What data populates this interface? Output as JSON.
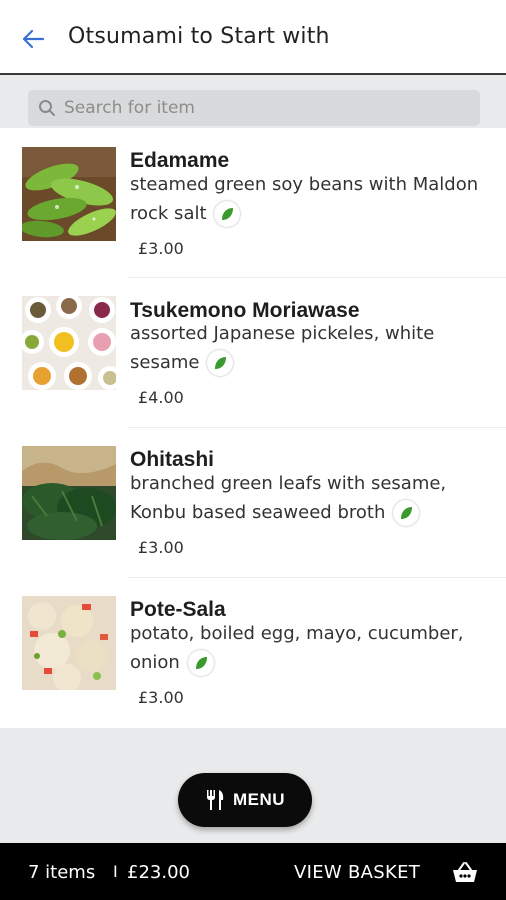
{
  "header": {
    "title": "Otsumami to Start with",
    "back_icon": "arrow-left-icon",
    "accent": "#3b6fd6"
  },
  "search": {
    "placeholder": "Search for item",
    "icon": "search-icon"
  },
  "items": [
    {
      "name": "Edamame",
      "desc": "steamed green soy beans with Maldon rock salt",
      "price": "£3.00",
      "vegetarian": true,
      "image": "edamame-photo"
    },
    {
      "name": "Tsukemono Moriawase",
      "desc": "assorted Japanese pickeles, white sesame",
      "price": "£4.00",
      "vegetarian": true,
      "image": "pickles-photo"
    },
    {
      "name": "Ohitashi",
      "desc": "branched green leafs with sesame, Konbu based seaweed broth",
      "price": "£3.00",
      "vegetarian": true,
      "image": "ohitashi-photo"
    },
    {
      "name": "Pote-Sala",
      "desc": "potato, boiled egg, mayo, cucumber, onion",
      "price": "£3.00",
      "vegetarian": true,
      "image": "potato-salad-photo"
    }
  ],
  "menu_button": {
    "label": "MENU",
    "icon": "cutlery-icon"
  },
  "basket": {
    "count": "7 items",
    "separator": "I",
    "total": "£23.00",
    "view_label": "VIEW BASKET",
    "icon": "basket-icon"
  },
  "colors": {
    "leaf_green": "#3a9a2e",
    "bar_bg": "#000000",
    "page_bg": "#e9eaeb"
  }
}
